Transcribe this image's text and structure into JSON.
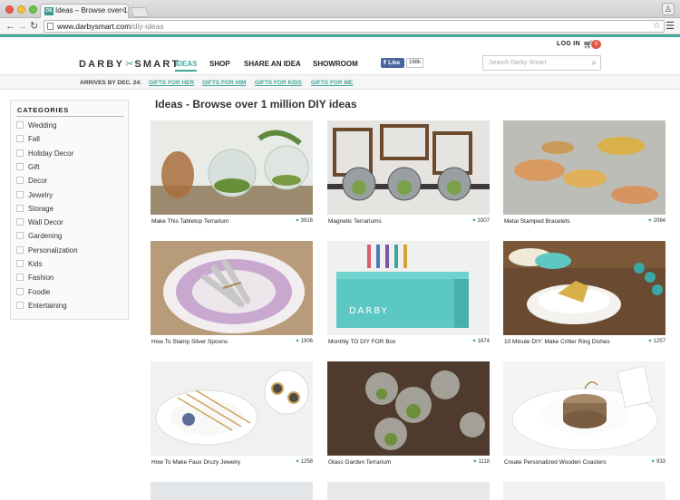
{
  "browser": {
    "tab_title": "Ideas – Browse over 1 milli",
    "favicon_text": "DS",
    "url_host": "www.darbysmart.com",
    "url_path": "/diy-ideas"
  },
  "header": {
    "login": "LOG IN",
    "cart_count": "0",
    "logo_left": "DARBY",
    "logo_right": "SMART",
    "nav": [
      "IDEAS",
      "SHOP",
      "SHARE AN IDEA",
      "SHOWROOM"
    ],
    "fb_like": "Like",
    "fb_count": "168k",
    "search_placeholder": "Search Darby Smart"
  },
  "subnav": {
    "arrives": "ARRIVES BY DEC. 24:",
    "links": [
      "GIFTS FOR HER",
      "GIFTS FOR HIM",
      "GIFTS FOR KIDS",
      "GIFTS FOR ME"
    ]
  },
  "sidebar": {
    "title": "CATEGORIES",
    "items": [
      "Wedding",
      "Fall",
      "Holiday Decor",
      "Gift",
      "Decor",
      "Jewelry",
      "Storage",
      "Wall Decor",
      "Gardening",
      "Personalization",
      "Kids",
      "Fashion",
      "Foodie",
      "Entertaining"
    ]
  },
  "main": {
    "heading": "Ideas - Browse over 1 million DIY ideas",
    "cards": [
      {
        "title": "Make This Tabletop Terrarium",
        "likes": "3916"
      },
      {
        "title": "Magnetic Terrariums",
        "likes": "3307"
      },
      {
        "title": "Metal Stamped Bracelets",
        "likes": "2064"
      },
      {
        "title": "How To Stamp Silver Spoons",
        "likes": "1906"
      },
      {
        "title": "Monthly TO DIY FOR Box",
        "likes": "1674"
      },
      {
        "title": "10 Minute DIY: Make Critter Ring Dishes",
        "likes": "1257"
      },
      {
        "title": "How To Make Faux Druzy Jewelry",
        "likes": "1258"
      },
      {
        "title": "Glass Garden Terrarium",
        "likes": "1118"
      },
      {
        "title": "Create Personalized Wooden Coasters",
        "likes": "933"
      }
    ]
  },
  "colors": {
    "accent": "#43a79a",
    "badge": "#e0574a",
    "facebook": "#4a66a0"
  }
}
